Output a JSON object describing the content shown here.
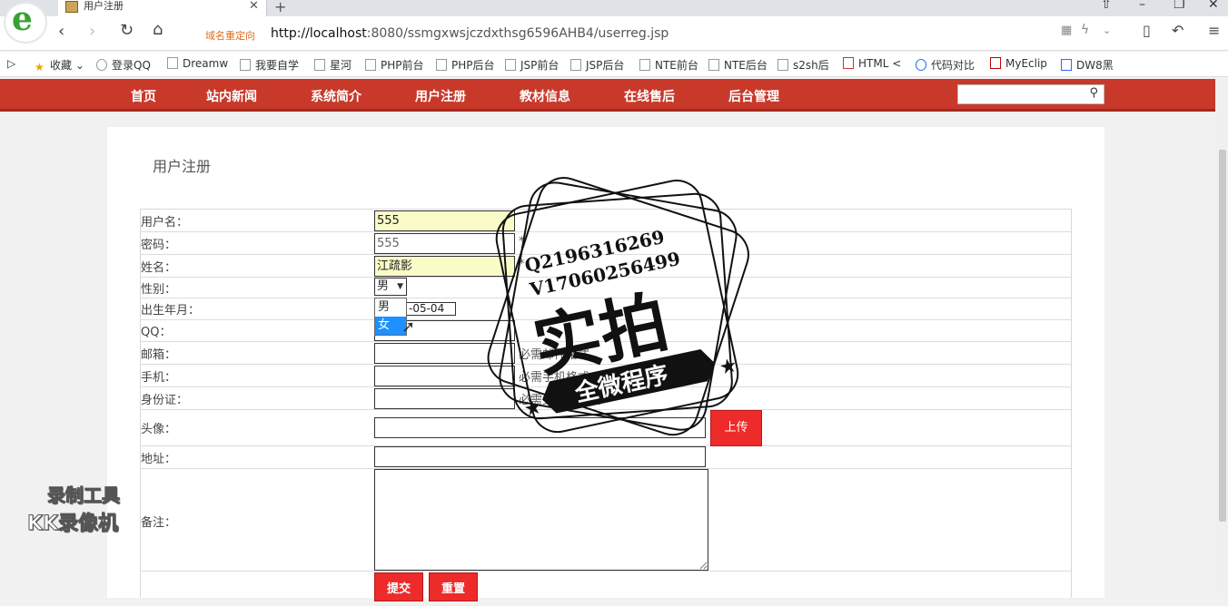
{
  "browser": {
    "tab_title": "用户注册",
    "redirect_label": "域名重定向",
    "url_host": "http://localhost",
    "url_rest": ":8080/ssmgxwsjczdxthsg6596AHB4/userreg.jsp",
    "bookmarks": [
      "收藏",
      "登录QQ",
      "Dreamw",
      "我要自学",
      "星河",
      "PHP前台",
      "PHP后台",
      "JSP前台",
      "JSP后台",
      "NTE前台",
      "NTE后台",
      "s2sh后",
      "HTML <",
      "代码对比",
      "MyEclip",
      "DW8黑"
    ]
  },
  "site_nav": {
    "items": [
      "首页",
      "站内新闻",
      "系统简介",
      "用户注册",
      "教材信息",
      "在线售后",
      "后台管理"
    ],
    "search_placeholder": ""
  },
  "form": {
    "title": "用户注册",
    "labels": {
      "username": "用户名：",
      "password": "密码：",
      "name": "姓名：",
      "gender": "性别：",
      "birth": "出生年月：",
      "qq": "QQ：",
      "email": "邮箱：",
      "phone": "手机：",
      "idcard": "身份证：",
      "avatar": "头像：",
      "address": "地址：",
      "remark": "备注："
    },
    "values": {
      "username": "555",
      "password": "555",
      "name": "江疏影",
      "gender": "男",
      "birth": "-05-04",
      "qq": "",
      "email": "",
      "phone": "",
      "idcard": ""
    },
    "hints": {
      "password": "*",
      "name": "*",
      "email": "必需邮件格式",
      "phone": "必需手机格式",
      "idcard": "必需身份证格式"
    },
    "gender_options": [
      "男",
      "女"
    ],
    "upload_label": "上传",
    "submit_label": "提交",
    "reset_label": "重置"
  },
  "overlay": {
    "stamp_line1": "Q2196316269",
    "stamp_line2": "V17060256499",
    "stamp_big": "实拍",
    "stamp_band": "全微程序",
    "watermark_line1": "录制工具",
    "watermark_line2": "KK录像机"
  }
}
